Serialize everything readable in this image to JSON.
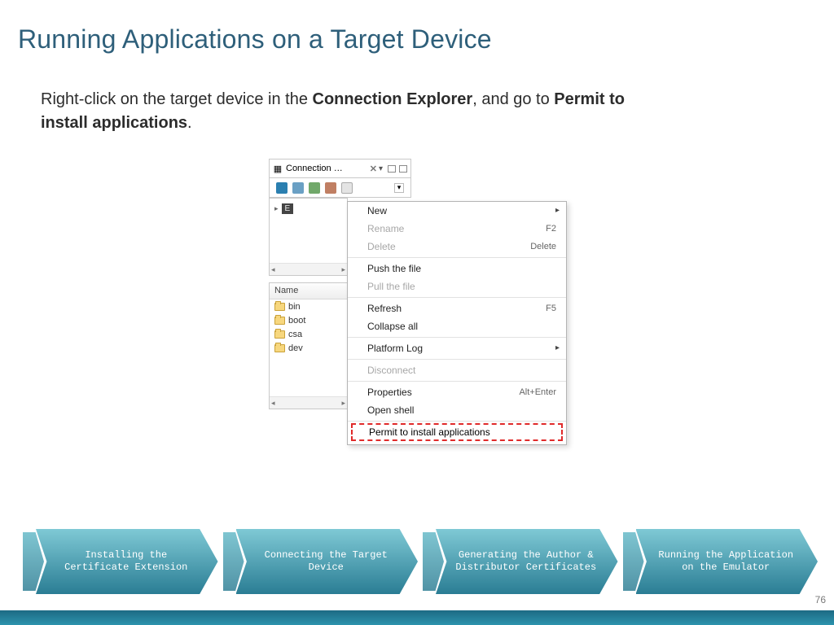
{
  "title": "Running Applications on a Target Device",
  "body": {
    "pre": "Right-click on the target device in the ",
    "bold1": "Connection Explorer",
    "mid": ", and go to ",
    "bold2": "Permit to install applications",
    "post": "."
  },
  "explorer": {
    "tab_label": "Connection …",
    "tab_close": "✕",
    "name_header": "Name",
    "device_chip": "E",
    "folders": [
      "bin",
      "boot",
      "csa",
      "dev"
    ]
  },
  "menu": {
    "new": "New",
    "rename": "Rename",
    "rename_k": "F2",
    "delete": "Delete",
    "delete_k": "Delete",
    "push": "Push the file",
    "pull": "Pull the file",
    "refresh": "Refresh",
    "refresh_k": "F5",
    "collapse": "Collapse all",
    "platlog": "Platform Log",
    "disconnect": "Disconnect",
    "properties": "Properties",
    "properties_k": "Alt+Enter",
    "shell": "Open shell",
    "permit": "Permit to install applications"
  },
  "steps": [
    "Installing the Certificate Extension",
    "Connecting the Target Device",
    "Generating the Author & Distributor Certificates",
    "Running the Application on the Emulator"
  ],
  "page_number": "76"
}
